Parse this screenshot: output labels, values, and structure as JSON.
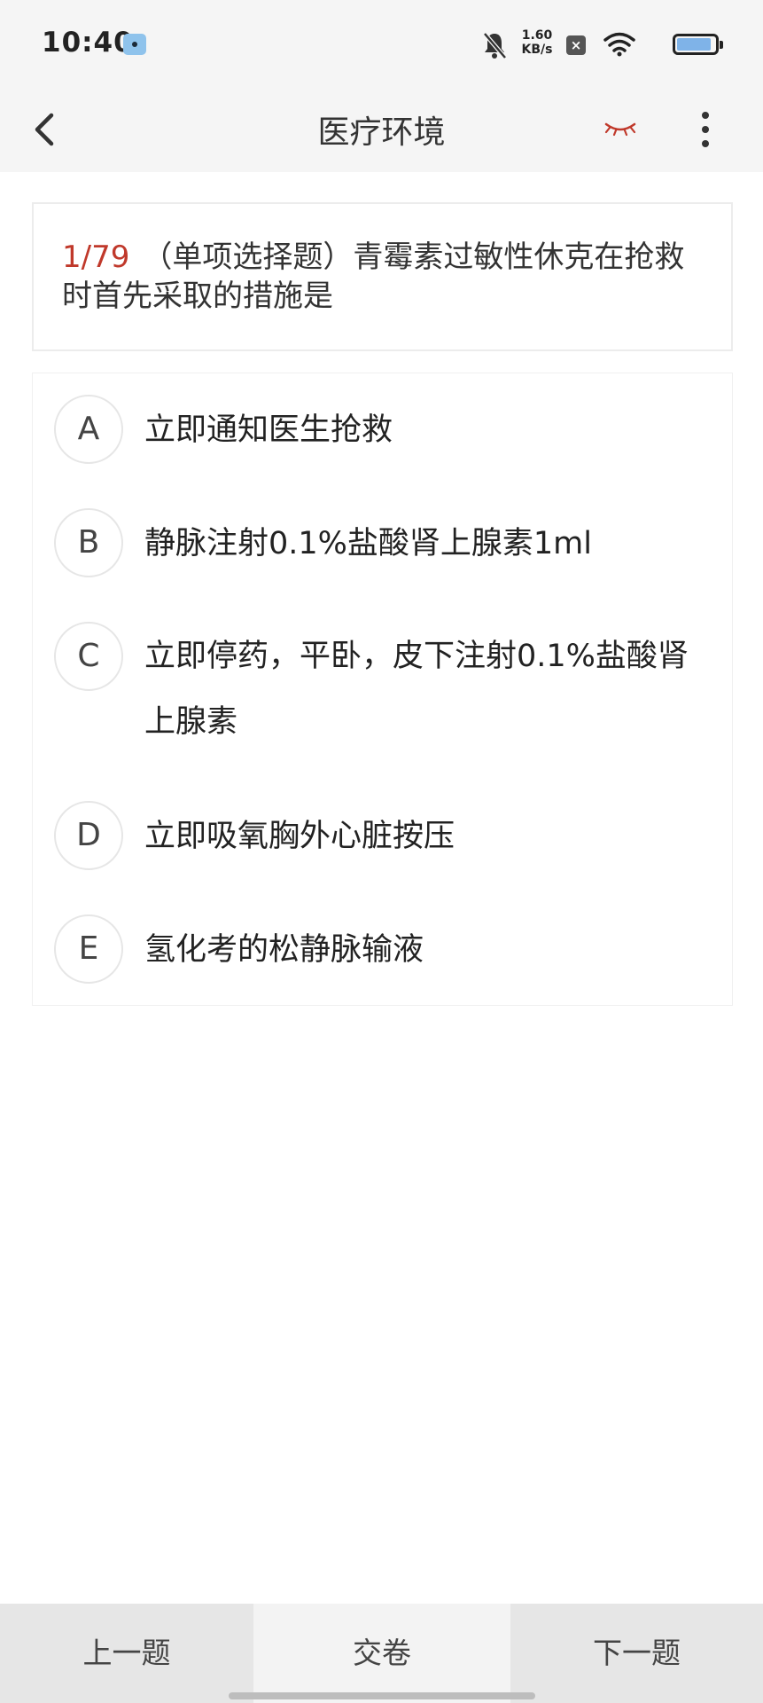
{
  "status_bar": {
    "time": "10:40",
    "net_speed_value": "1.60",
    "net_speed_unit": "KB/s",
    "icons": [
      "app-notification-icon",
      "mute-bell-icon",
      "close-box-icon",
      "wifi-icon",
      "battery-icon"
    ]
  },
  "header": {
    "title": "医疗环境",
    "icons": [
      "back-chevron-icon",
      "closed-eye-icon",
      "more-vertical-icon"
    ],
    "accent_color": "#c0392b"
  },
  "question": {
    "number": "1/79",
    "text": "（单项选择题）青霉素过敏性休克在抢救时首先采取的措施是"
  },
  "options": [
    {
      "letter": "A",
      "text": "立即通知医生抢救"
    },
    {
      "letter": "B",
      "text": "静脉注射0.1%盐酸肾上腺素1ml"
    },
    {
      "letter": "C",
      "text": "立即停药，平卧，皮下注射0.1%盐酸肾上腺素"
    },
    {
      "letter": "D",
      "text": "立即吸氧胸外心脏按压"
    },
    {
      "letter": "E",
      "text": "氢化考的松静脉输液"
    }
  ],
  "bottom_bar": {
    "prev_label": "上一题",
    "submit_label": "交卷",
    "next_label": "下一题"
  }
}
